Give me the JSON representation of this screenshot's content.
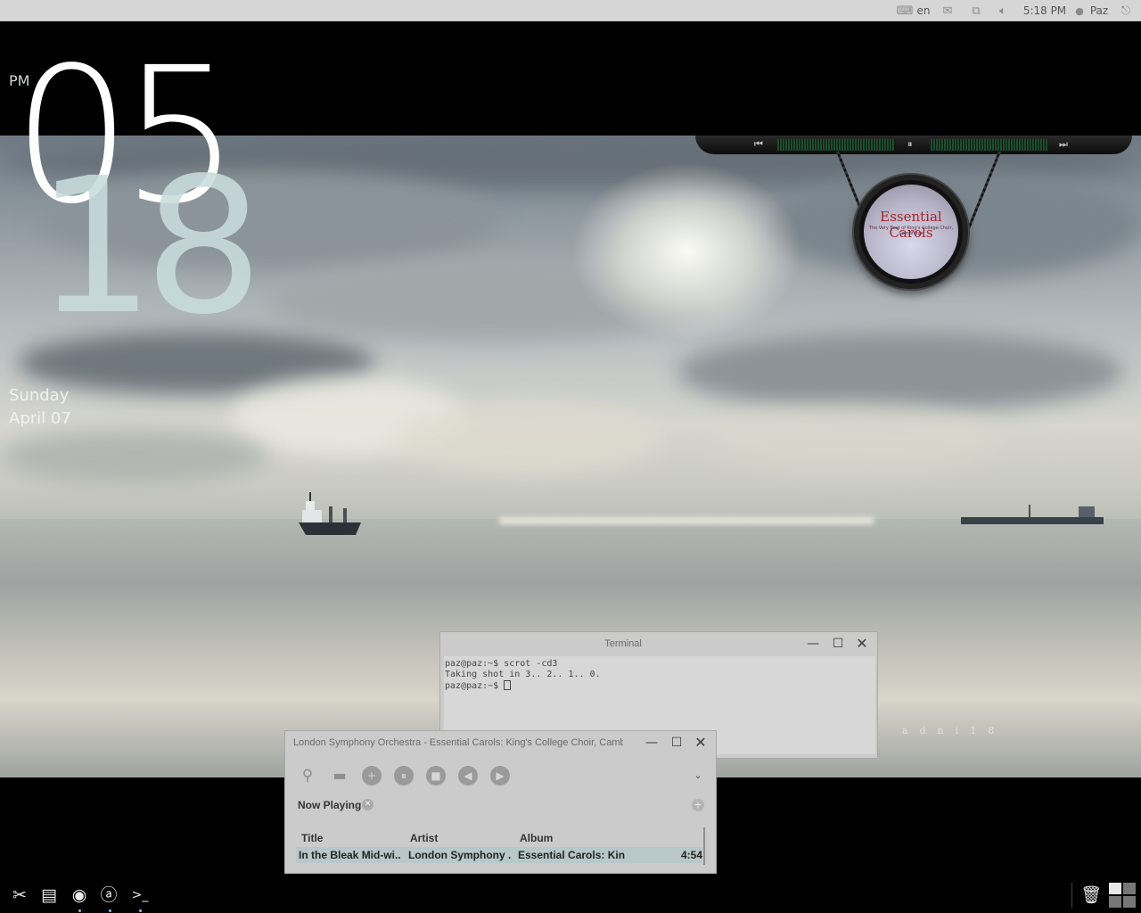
{
  "top_panel": {
    "keyboard_icon": "keyboard-icon",
    "language": "en",
    "mail_icon": "mail-icon",
    "network_icon": "network-icon",
    "volume_icon": "volume-icon",
    "time": "5:18 PM",
    "user_icon": "user-icon",
    "user_name": "Paz",
    "logout_icon": "logout-icon"
  },
  "clock": {
    "ampm": "PM",
    "hour": "05",
    "minute": "18",
    "day": "Sunday",
    "date": "April  07"
  },
  "music_widget": {
    "prev_icon": "previous-icon",
    "pause_icon": "pause-icon",
    "next_icon": "next-icon",
    "cover_title": "Essential Carols",
    "cover_subtitle": "The Very Best of King's College Choir, Cambridge"
  },
  "signature": "adni18",
  "terminal": {
    "title": "Terminal",
    "lines": [
      "paz@paz:~$ scrot -cd3",
      "Taking shot in 3.. 2.. 1.. 0.",
      "paz@paz:~$ "
    ]
  },
  "player": {
    "title": "London Symphony Orchestra - Essential Carols: King's College Choir, Cambridge - In the",
    "toolbar": [
      "search-icon",
      "folder-icon",
      "add-icon",
      "pause-icon",
      "stop-icon",
      "previous-icon",
      "next-icon"
    ],
    "tab_label": "Now Playing",
    "columns": [
      "Title",
      "Artist",
      "Album"
    ],
    "rows": [
      {
        "title": "In the Bleak Mid-wi...",
        "artist": "London Symphony ...",
        "album": "Essential Carols: Kin...",
        "duration": "4:54"
      }
    ]
  },
  "dock": {
    "left": [
      "tools-icon",
      "file-manager-icon",
      "firefox-icon",
      "at-icon",
      "terminal-icon"
    ],
    "right": [
      "trash-icon",
      "workspaces-icon"
    ]
  },
  "colors": {
    "panel": "#d6d6d6",
    "window": "#cbcbcb",
    "selection": "#b8c8c8",
    "clock_minute": "#c8dcdc"
  }
}
